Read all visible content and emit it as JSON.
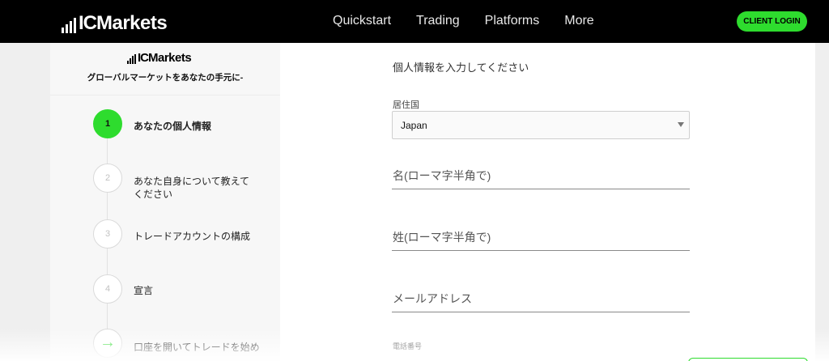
{
  "nav": {
    "logo_ic": "IC",
    "logo_markets": "Markets",
    "links": [
      "Quickstart",
      "Trading",
      "Platforms",
      "More"
    ],
    "login_label": "CLIENT LOGIN"
  },
  "sidebar": {
    "logo_ic": "IC",
    "logo_markets": "Markets",
    "tagline": "グローバルマーケットをあなたの手元に-",
    "steps": [
      {
        "number": "1",
        "label": "あなたの個人情報",
        "active": true
      },
      {
        "number": "2",
        "label": "あなた自身について教えてください",
        "active": false
      },
      {
        "number": "3",
        "label": "トレードアカウントの構成",
        "active": false
      },
      {
        "number": "4",
        "label": "宣言",
        "active": false
      },
      {
        "number": "→",
        "label": "口座を開いてトレードを始め",
        "active": false
      }
    ]
  },
  "form": {
    "heading": "個人情報を入力してください",
    "country_label": "居住国",
    "country_value": "Japan",
    "first_name_placeholder": "名(ローマ字半角で)",
    "last_name_placeholder": "姓(ローマ字半角で)",
    "email_placeholder": "メールアドレス",
    "phone_label": "電話番号"
  },
  "colors": {
    "accent": "#2edc2e",
    "nav_bg": "#000000"
  },
  "icons": [
    "logo-bars-icon",
    "dropdown-caret-icon",
    "arrow-right-icon"
  ]
}
